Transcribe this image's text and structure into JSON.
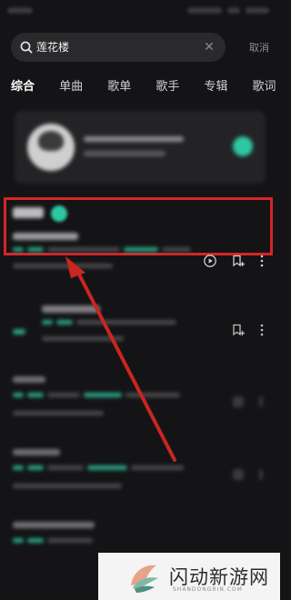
{
  "search": {
    "query": "莲花楼",
    "cancel_label": "取消"
  },
  "tabs": [
    {
      "label": "综合",
      "active": true
    },
    {
      "label": "单曲",
      "active": false
    },
    {
      "label": "歌单",
      "active": false
    },
    {
      "label": "歌手",
      "active": false
    },
    {
      "label": "专辑",
      "active": false
    },
    {
      "label": "歌词",
      "active": false
    }
  ],
  "colors": {
    "accent": "#2ec7a1",
    "highlight": "#d62525",
    "background": "#141416"
  },
  "icons": {
    "search": "search-icon",
    "clear": "close-icon",
    "play": "play-circle-icon",
    "collect": "add-to-collection-icon",
    "more": "more-vertical-icon"
  },
  "watermark": {
    "title": "闪动新游网",
    "subtitle": "SHANDONGRIN.COM"
  }
}
